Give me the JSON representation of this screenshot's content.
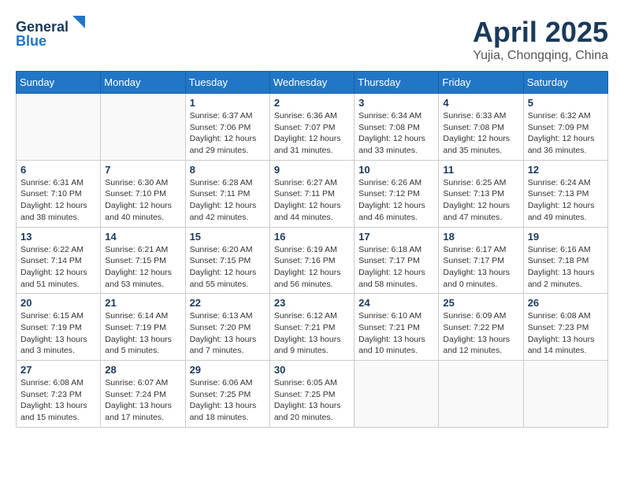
{
  "header": {
    "logo_general": "General",
    "logo_blue": "Blue",
    "month_title": "April 2025",
    "location": "Yujia, Chongqing, China"
  },
  "days_of_week": [
    "Sunday",
    "Monday",
    "Tuesday",
    "Wednesday",
    "Thursday",
    "Friday",
    "Saturday"
  ],
  "weeks": [
    [
      {
        "day": "",
        "sunrise": "",
        "sunset": "",
        "daylight": ""
      },
      {
        "day": "",
        "sunrise": "",
        "sunset": "",
        "daylight": ""
      },
      {
        "day": "1",
        "sunrise": "Sunrise: 6:37 AM",
        "sunset": "Sunset: 7:06 PM",
        "daylight": "Daylight: 12 hours and 29 minutes."
      },
      {
        "day": "2",
        "sunrise": "Sunrise: 6:36 AM",
        "sunset": "Sunset: 7:07 PM",
        "daylight": "Daylight: 12 hours and 31 minutes."
      },
      {
        "day": "3",
        "sunrise": "Sunrise: 6:34 AM",
        "sunset": "Sunset: 7:08 PM",
        "daylight": "Daylight: 12 hours and 33 minutes."
      },
      {
        "day": "4",
        "sunrise": "Sunrise: 6:33 AM",
        "sunset": "Sunset: 7:08 PM",
        "daylight": "Daylight: 12 hours and 35 minutes."
      },
      {
        "day": "5",
        "sunrise": "Sunrise: 6:32 AM",
        "sunset": "Sunset: 7:09 PM",
        "daylight": "Daylight: 12 hours and 36 minutes."
      }
    ],
    [
      {
        "day": "6",
        "sunrise": "Sunrise: 6:31 AM",
        "sunset": "Sunset: 7:10 PM",
        "daylight": "Daylight: 12 hours and 38 minutes."
      },
      {
        "day": "7",
        "sunrise": "Sunrise: 6:30 AM",
        "sunset": "Sunset: 7:10 PM",
        "daylight": "Daylight: 12 hours and 40 minutes."
      },
      {
        "day": "8",
        "sunrise": "Sunrise: 6:28 AM",
        "sunset": "Sunset: 7:11 PM",
        "daylight": "Daylight: 12 hours and 42 minutes."
      },
      {
        "day": "9",
        "sunrise": "Sunrise: 6:27 AM",
        "sunset": "Sunset: 7:11 PM",
        "daylight": "Daylight: 12 hours and 44 minutes."
      },
      {
        "day": "10",
        "sunrise": "Sunrise: 6:26 AM",
        "sunset": "Sunset: 7:12 PM",
        "daylight": "Daylight: 12 hours and 46 minutes."
      },
      {
        "day": "11",
        "sunrise": "Sunrise: 6:25 AM",
        "sunset": "Sunset: 7:13 PM",
        "daylight": "Daylight: 12 hours and 47 minutes."
      },
      {
        "day": "12",
        "sunrise": "Sunrise: 6:24 AM",
        "sunset": "Sunset: 7:13 PM",
        "daylight": "Daylight: 12 hours and 49 minutes."
      }
    ],
    [
      {
        "day": "13",
        "sunrise": "Sunrise: 6:22 AM",
        "sunset": "Sunset: 7:14 PM",
        "daylight": "Daylight: 12 hours and 51 minutes."
      },
      {
        "day": "14",
        "sunrise": "Sunrise: 6:21 AM",
        "sunset": "Sunset: 7:15 PM",
        "daylight": "Daylight: 12 hours and 53 minutes."
      },
      {
        "day": "15",
        "sunrise": "Sunrise: 6:20 AM",
        "sunset": "Sunset: 7:15 PM",
        "daylight": "Daylight: 12 hours and 55 minutes."
      },
      {
        "day": "16",
        "sunrise": "Sunrise: 6:19 AM",
        "sunset": "Sunset: 7:16 PM",
        "daylight": "Daylight: 12 hours and 56 minutes."
      },
      {
        "day": "17",
        "sunrise": "Sunrise: 6:18 AM",
        "sunset": "Sunset: 7:17 PM",
        "daylight": "Daylight: 12 hours and 58 minutes."
      },
      {
        "day": "18",
        "sunrise": "Sunrise: 6:17 AM",
        "sunset": "Sunset: 7:17 PM",
        "daylight": "Daylight: 13 hours and 0 minutes."
      },
      {
        "day": "19",
        "sunrise": "Sunrise: 6:16 AM",
        "sunset": "Sunset: 7:18 PM",
        "daylight": "Daylight: 13 hours and 2 minutes."
      }
    ],
    [
      {
        "day": "20",
        "sunrise": "Sunrise: 6:15 AM",
        "sunset": "Sunset: 7:19 PM",
        "daylight": "Daylight: 13 hours and 3 minutes."
      },
      {
        "day": "21",
        "sunrise": "Sunrise: 6:14 AM",
        "sunset": "Sunset: 7:19 PM",
        "daylight": "Daylight: 13 hours and 5 minutes."
      },
      {
        "day": "22",
        "sunrise": "Sunrise: 6:13 AM",
        "sunset": "Sunset: 7:20 PM",
        "daylight": "Daylight: 13 hours and 7 minutes."
      },
      {
        "day": "23",
        "sunrise": "Sunrise: 6:12 AM",
        "sunset": "Sunset: 7:21 PM",
        "daylight": "Daylight: 13 hours and 9 minutes."
      },
      {
        "day": "24",
        "sunrise": "Sunrise: 6:10 AM",
        "sunset": "Sunset: 7:21 PM",
        "daylight": "Daylight: 13 hours and 10 minutes."
      },
      {
        "day": "25",
        "sunrise": "Sunrise: 6:09 AM",
        "sunset": "Sunset: 7:22 PM",
        "daylight": "Daylight: 13 hours and 12 minutes."
      },
      {
        "day": "26",
        "sunrise": "Sunrise: 6:08 AM",
        "sunset": "Sunset: 7:23 PM",
        "daylight": "Daylight: 13 hours and 14 minutes."
      }
    ],
    [
      {
        "day": "27",
        "sunrise": "Sunrise: 6:08 AM",
        "sunset": "Sunset: 7:23 PM",
        "daylight": "Daylight: 13 hours and 15 minutes."
      },
      {
        "day": "28",
        "sunrise": "Sunrise: 6:07 AM",
        "sunset": "Sunset: 7:24 PM",
        "daylight": "Daylight: 13 hours and 17 minutes."
      },
      {
        "day": "29",
        "sunrise": "Sunrise: 6:06 AM",
        "sunset": "Sunset: 7:25 PM",
        "daylight": "Daylight: 13 hours and 18 minutes."
      },
      {
        "day": "30",
        "sunrise": "Sunrise: 6:05 AM",
        "sunset": "Sunset: 7:25 PM",
        "daylight": "Daylight: 13 hours and 20 minutes."
      },
      {
        "day": "",
        "sunrise": "",
        "sunset": "",
        "daylight": ""
      },
      {
        "day": "",
        "sunrise": "",
        "sunset": "",
        "daylight": ""
      },
      {
        "day": "",
        "sunrise": "",
        "sunset": "",
        "daylight": ""
      }
    ]
  ]
}
